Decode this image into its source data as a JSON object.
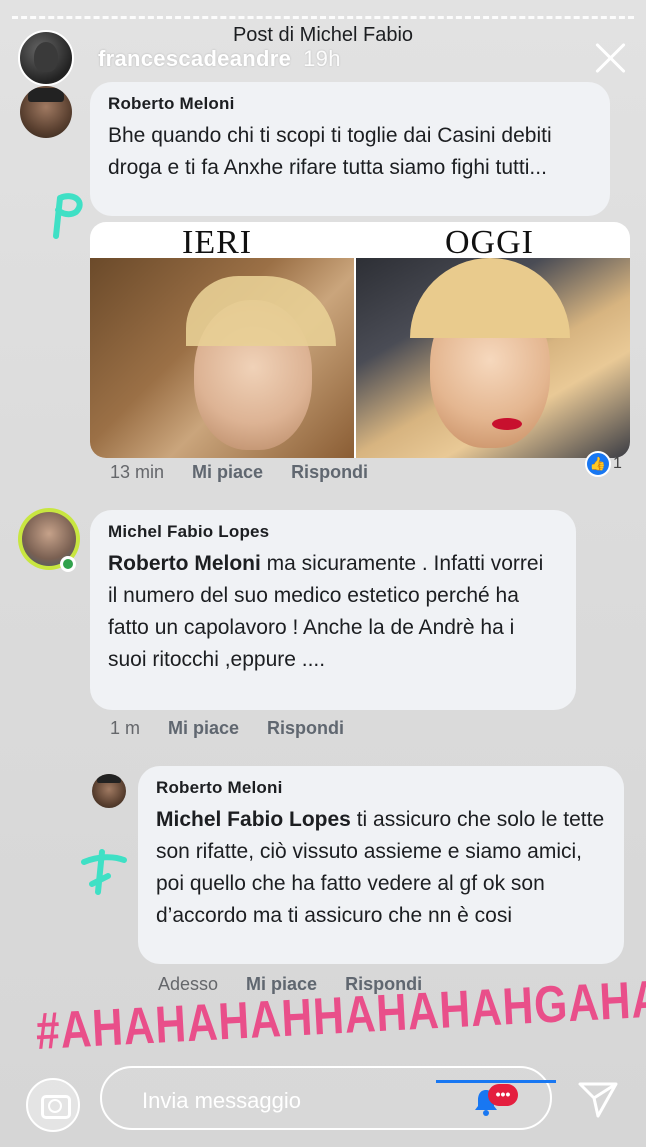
{
  "story": {
    "post_title": "Post di Michel Fabio",
    "username": "francescadeandre",
    "time": "19h",
    "hashtag": "#AHAHAHAHHAHAHAHGAHAHAHAH",
    "message_placeholder": "Invia messaggio"
  },
  "comments": [
    {
      "author": "Roberto Meloni",
      "text": "Bhe quando chi ti scopi ti toglie dai Casini debiti droga e ti fa Anxhe rifare tutta siamo fighi tutti...",
      "image_labels": [
        "IERI",
        "OGGI"
      ],
      "time": "13 min",
      "like": "Mi piace",
      "reply": "Rispondi",
      "reactions": "1"
    },
    {
      "author": "Michel Fabio Lopes",
      "mention": "Roberto Meloni",
      "text": " ma sicuramente . Infatti vorrei il numero del suo medico estetico perché ha fatto un capolavoro ! Anche la de Andrè ha i suoi ritocchi ,eppure ....",
      "time": "1 m",
      "like": "Mi piace",
      "reply": "Rispondi"
    },
    {
      "author": "Roberto Meloni",
      "mention": "Michel Fabio Lopes",
      "text": " ti assicuro che solo le tette son rifatte, ciò vissuto assieme e siamo amici, poi quello che ha fatto vedere al gf ok son d’accordo ma ti assicuro che nn è cosi",
      "time": "Adesso",
      "like": "Mi piace",
      "reply": "Rispondi"
    }
  ],
  "colors": {
    "bubble": "#f0f2f5",
    "hashtag": "#e94f8a",
    "scribble": "#3fe0c5",
    "facebook_blue": "#1877f2",
    "notification_red": "#e41e3f"
  },
  "icons": [
    "close-icon",
    "camera-icon",
    "send-icon",
    "like-icon",
    "notification-bell-icon",
    "menu-icon"
  ]
}
